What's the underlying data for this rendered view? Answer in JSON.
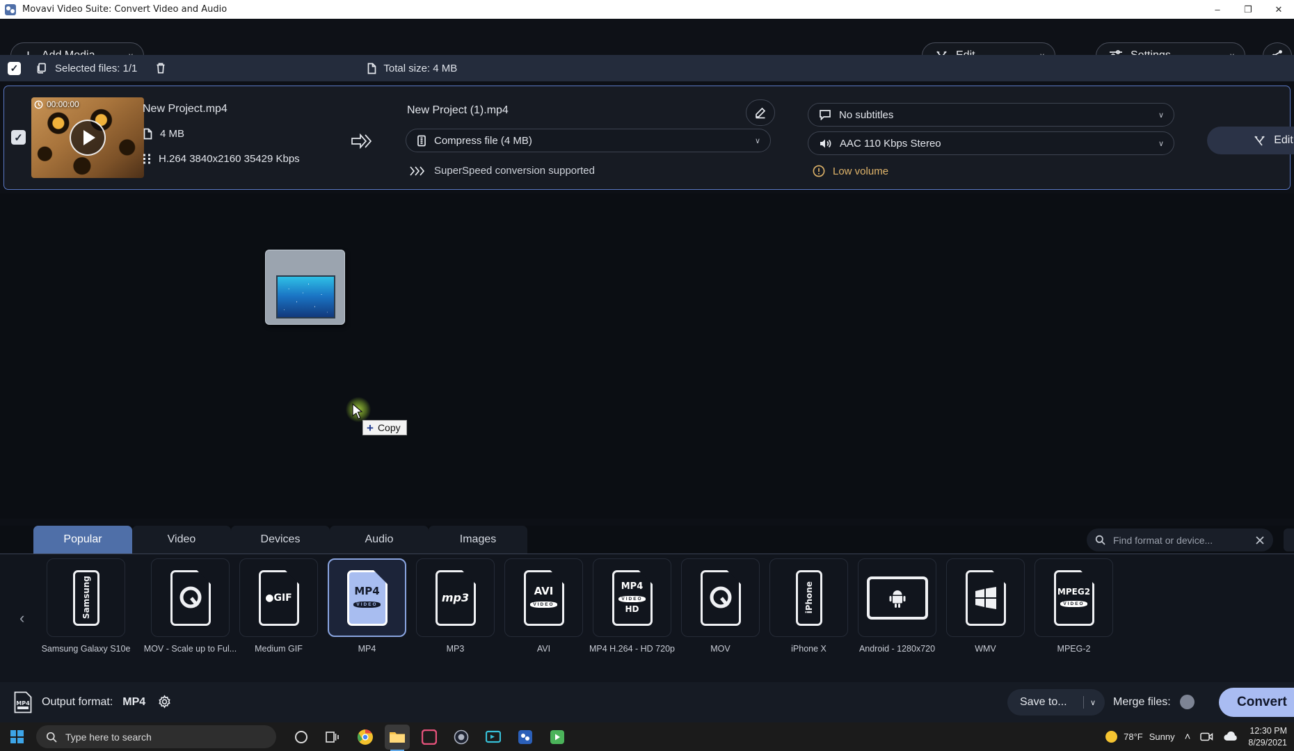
{
  "window": {
    "title": "Movavi Video Suite: Convert Video and Audio",
    "icon": "movavi-logo-icon",
    "minimize": "–",
    "restore": "❐",
    "close": "✕"
  },
  "toolbar": {
    "add_media": "Add Media",
    "edit": "Edit",
    "settings": "Settings",
    "share_icon": "share-icon",
    "chevron": "∨"
  },
  "selection_bar": {
    "checkbox_state": "✓",
    "selected_files": "Selected files: 1/1",
    "total_size": "Total size: 4 MB",
    "trash_icon": "trash-icon"
  },
  "file_card": {
    "checkbox_state": "✓",
    "duration": "00:00:00",
    "source_name": "New Project.mp4",
    "source_size": "4 MB",
    "source_codec": "H.264 3840x2160 35429 Kbps",
    "output_name": "New Project (1).mp4",
    "compress_option": "Compress file (4 MB)",
    "subtitles_option": "No subtitles",
    "audio_option": "AAC 110 Kbps Stereo",
    "superspeed_note": "SuperSpeed conversion supported",
    "volume_warning": "Low volume",
    "edit_button": "Edit",
    "chevron": "∨"
  },
  "canvas": {
    "drag_tooltip": "Copy",
    "drag_tooltip_plus": "+"
  },
  "format_tabs": [
    {
      "label": "Popular",
      "active": true
    },
    {
      "label": "Video",
      "active": false
    },
    {
      "label": "Devices",
      "active": false
    },
    {
      "label": "Audio",
      "active": false
    },
    {
      "label": "Images",
      "active": false
    }
  ],
  "search": {
    "placeholder": "Find format or device...",
    "value": "",
    "icon": "search-icon",
    "clear_icon": "close-icon"
  },
  "presets": [
    {
      "label": "Samsung Galaxy S10e",
      "glyph": "Samsung",
      "kind": "phone",
      "selected": false
    },
    {
      "label": "MOV - Scale up to Ful...",
      "glyph": "Q",
      "kind": "quicktime",
      "selected": false
    },
    {
      "label": "Medium GIF",
      "glyph": "GIF",
      "kind": "gif",
      "selected": false
    },
    {
      "label": "MP4",
      "glyph": "MP4",
      "sub": "VIDEO",
      "kind": "doc",
      "selected": true
    },
    {
      "label": "MP3",
      "glyph": "mp3",
      "kind": "mp3",
      "selected": false
    },
    {
      "label": "AVI",
      "glyph": "AVI",
      "sub": "VIDEO",
      "kind": "doc",
      "selected": false
    },
    {
      "label": "MP4 H.264 - HD 720p",
      "glyph": "MP4",
      "sub": "VIDEO",
      "sub2": "HD",
      "kind": "doc",
      "selected": false
    },
    {
      "label": "MOV",
      "glyph": "Q",
      "kind": "quicktime",
      "selected": false
    },
    {
      "label": "iPhone X",
      "glyph": "iPhone",
      "kind": "phone",
      "selected": false
    },
    {
      "label": "Android - 1280x720",
      "glyph": "android",
      "kind": "tablet",
      "selected": false
    },
    {
      "label": "WMV",
      "glyph": "windows",
      "kind": "windows",
      "selected": false
    },
    {
      "label": "MPEG-2",
      "glyph": "MPEG2",
      "sub": "VIDEO",
      "kind": "doc",
      "selected": false
    }
  ],
  "scroll_left_icon": "chevron-left-icon",
  "bottom_bar": {
    "output_format_label": "Output format:",
    "output_format_value": "MP4",
    "gear_icon": "gear-icon",
    "save_to": "Save to...",
    "merge_files": "Merge files:",
    "merge_enabled": false,
    "convert": "Convert",
    "chevron": "∨"
  },
  "taskbar": {
    "start_icon": "windows-start-icon",
    "search_placeholder": "Type here to search",
    "apps": [
      {
        "name": "cortana-icon"
      },
      {
        "name": "task-view-icon"
      },
      {
        "name": "chrome-icon"
      },
      {
        "name": "file-explorer-icon"
      },
      {
        "name": "app-pink-icon"
      },
      {
        "name": "camera-icon"
      },
      {
        "name": "screen-recorder-icon"
      },
      {
        "name": "blue-app-icon"
      },
      {
        "name": "movavi-icon"
      }
    ],
    "weather_temp": "78°F",
    "weather_desc": "Sunny",
    "time": "12:30 PM",
    "date": "8/29/2021",
    "chevron_up": "˄"
  },
  "colors": {
    "accent": "#4f6fa8",
    "convert_button": "#a9bcf2",
    "warning": "#e0b46a",
    "card_border": "#5b79c4",
    "selection_bar": "#242c3c"
  }
}
